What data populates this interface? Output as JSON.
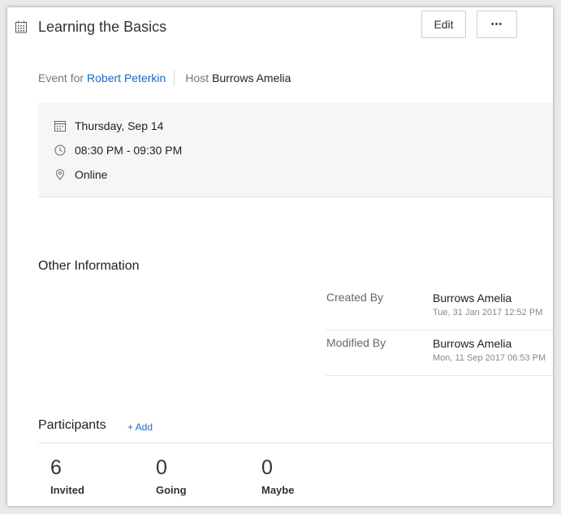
{
  "event": {
    "title": "Learning the Basics",
    "edit_label": "Edit",
    "more_label": "•••"
  },
  "meta": {
    "event_for_label": "Event for",
    "event_for_name": "Robert Peterkin",
    "host_label": "Host",
    "host_name": "Burrows Amelia"
  },
  "details": {
    "date": "Thursday, Sep 14",
    "time": "08:30 PM - 09:30 PM",
    "location": "Online"
  },
  "other_info": {
    "title": "Other Information",
    "rows": [
      {
        "label": "Created By",
        "value": "Burrows Amelia",
        "timestamp": "Tue, 31 Jan 2017 12:52 PM"
      },
      {
        "label": "Modified By",
        "value": "Burrows Amelia",
        "timestamp": "Mon, 11 Sep 2017 06:53 PM"
      }
    ]
  },
  "participants": {
    "title": "Participants",
    "add_label": "+ Add",
    "stats": [
      {
        "count": "6",
        "label": "Invited"
      },
      {
        "count": "0",
        "label": "Going"
      },
      {
        "count": "0",
        "label": "Maybe"
      }
    ]
  },
  "colors": {
    "link": "#1a68c1",
    "info_background": "#f6f6f6"
  },
  "icons": {
    "header": "calendar-grid-icon",
    "date": "calendar-icon",
    "time": "clock-icon",
    "location": "location-pin-icon",
    "more": "more-dots-icon"
  }
}
